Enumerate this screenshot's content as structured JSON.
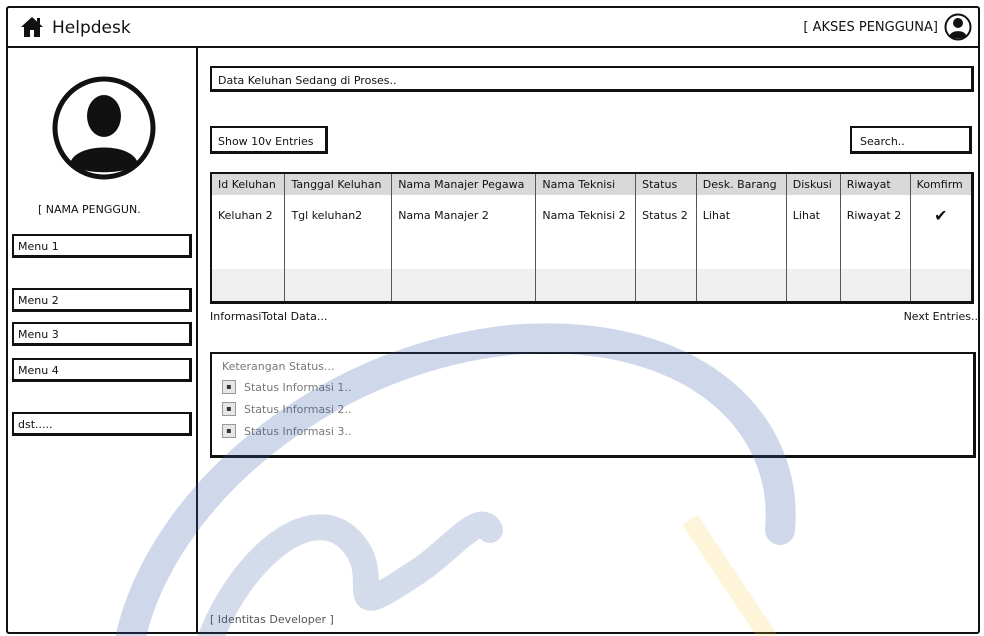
{
  "header": {
    "title": "Helpdesk",
    "access_label": "[ AKSES PENGGUNA]"
  },
  "sidebar": {
    "user_name": "[ NAMA PENGGUN.",
    "menus": [
      "Menu 1",
      "Menu 2",
      "Menu 3",
      "Menu 4",
      "dst....."
    ]
  },
  "main": {
    "page_title": "Data Keluhan Sedang di Proses..",
    "show_entries": "Show 10v Entries",
    "search_placeholder": "Search..",
    "table": {
      "headers": [
        "Id Keluhan",
        "Tanggal Keluhan",
        "Nama Manajer Pegawa",
        "Nama Teknisi",
        "Status",
        "Desk. Barang",
        "Diskusi",
        "Riwayat",
        "Komfirm"
      ],
      "rows": [
        [
          "Keluhan 2",
          "Tgl keluhan2",
          "Nama Manajer 2",
          "Nama Teknisi 2",
          "Status 2",
          "Lihat",
          "Lihat",
          "Riwayat 2",
          "✔"
        ]
      ]
    },
    "info_total": "InformasiTotal Data...",
    "next_entries": "Next Entries..",
    "status_panel": {
      "heading": "Keterangan Status...",
      "items": [
        "Status Informasi 1..",
        "Status Informasi 2..",
        "Status Informasi 3.."
      ]
    },
    "developer": "[ Identitas Developer ]"
  },
  "colors": {
    "watermark_blue": "#3b5ea8",
    "watermark_yellow": "#f4c542"
  }
}
